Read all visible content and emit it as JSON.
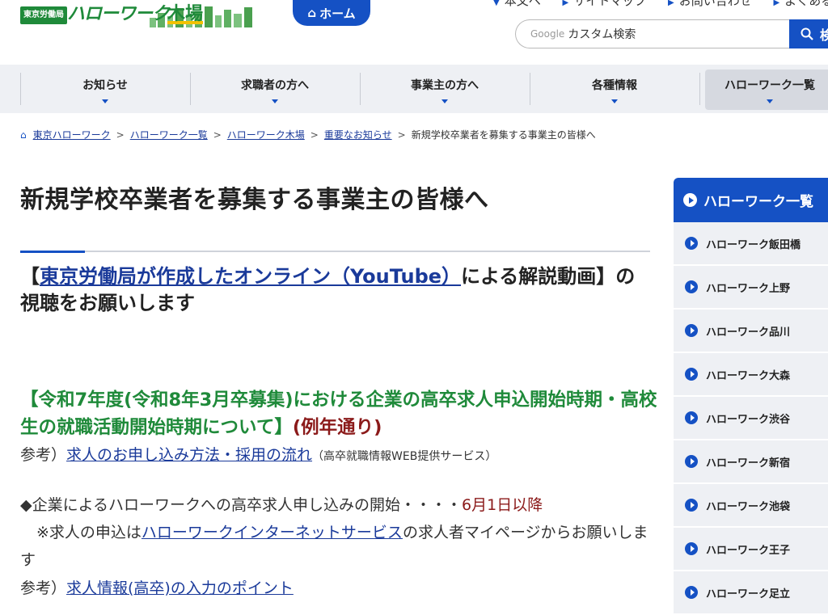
{
  "header": {
    "logo_badge": "東京労働局",
    "logo_name": "ハローワーク",
    "logo_branch": "木場",
    "home_label": "ホーム",
    "top_links": [
      "本文へ",
      "サイトマップ",
      "お問い合わせ",
      "よくある"
    ],
    "search_google": "Google",
    "search_placeholder": "カスタム検索",
    "search_button": "検"
  },
  "nav": [
    "お知らせ",
    "求職者の方へ",
    "事業主の方へ",
    "各種情報",
    "ハローワーク一覧"
  ],
  "breadcrumb": [
    "東京ハローワーク",
    "ハローワーク一覧",
    "ハローワーク木場",
    "重要なお知らせ",
    "新規学校卒業者を募集する事業主の皆様へ"
  ],
  "main": {
    "title": "新規学校卒業者を募集する事業主の皆様へ",
    "h2_prefix": "【",
    "h2_link": "東京労働局が作成したオンライン（YouTube）",
    "h2_suffix": "による解説動画】の視聴をお願いします",
    "green_heading": "【令和7年度(令和8年3月卒募集)における企業の高卒求人申込開始時期・高校生の就職活動開始時期について】",
    "green_tail": "(例年通り)",
    "ref1_prefix": "参考）",
    "ref1_link": "求人のお申し込み方法・採用の流れ",
    "ref1_note": "（高卒就職情報WEB提供サービス）",
    "bullet_text": "◆企業によるハローワークへの高卒求人申し込みの開始・・・・",
    "bullet_date": "6月1日以降",
    "note_prefix": "※求人の申込は",
    "note_link": "ハローワークインターネットサービス",
    "note_suffix": "の求人者マイページからお願いします",
    "ref2_prefix": "参考）",
    "ref2_link": "求人情報(高卒)の入力のポイント"
  },
  "sidebar": {
    "title": "ハローワーク一覧",
    "items": [
      "ハローワーク飯田橋",
      "ハローワーク上野",
      "ハローワーク品川",
      "ハローワーク大森",
      "ハローワーク渋谷",
      "ハローワーク新宿",
      "ハローワーク池袋",
      "ハローワーク王子",
      "ハローワーク足立"
    ]
  },
  "colors": {
    "accent": "#1551c4",
    "green": "#1f8a3a",
    "dark_red": "#8b1a1a",
    "nav_bg": "#eef0f4"
  }
}
